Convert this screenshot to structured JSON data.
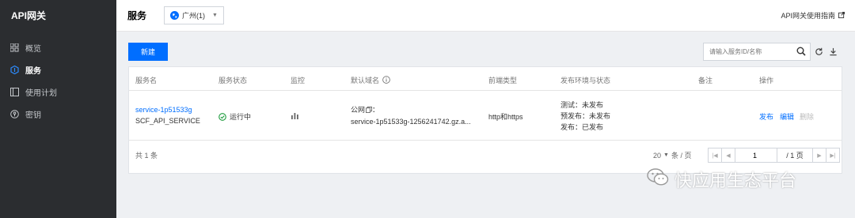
{
  "app": {
    "brand": "API网关"
  },
  "sidebar": {
    "items": [
      {
        "label": "概览",
        "icon": "grid-icon",
        "active": false
      },
      {
        "label": "服务",
        "icon": "service-icon",
        "active": true
      },
      {
        "label": "使用计划",
        "icon": "plan-icon",
        "active": false
      },
      {
        "label": "密钥",
        "icon": "key-icon",
        "active": false
      }
    ]
  },
  "header": {
    "title": "服务",
    "region": "广州(1)",
    "guide_link": "API网关使用指南"
  },
  "toolbar": {
    "new_button": "新建",
    "search_placeholder": "请输入服务ID/名称"
  },
  "table": {
    "headers": [
      "服务名",
      "服务状态",
      "监控",
      "默认域名",
      "前端类型",
      "发布环境与状态",
      "备注",
      "操作"
    ],
    "rows": [
      {
        "name": "service-1p51533g",
        "sub_name": "SCF_API_SERVICE",
        "status": "运行中",
        "domain_label": "公网",
        "domain": "service-1p51533g-1256241742.gz.a...",
        "frontend": "http和https",
        "env_test": "测试：未发布",
        "env_prepub": "预发布：未发布",
        "env_release": "发布：已发布",
        "remark": "",
        "actions": [
          "发布",
          "编辑",
          "删除"
        ]
      }
    ]
  },
  "footer": {
    "total_text": "共 1 条",
    "page_size": "20",
    "page_size_unit": "条 / 页",
    "page_input": "1",
    "page_total": "/ 1 页"
  },
  "watermark": {
    "text": "快应用生态平台"
  },
  "colors": {
    "accent": "#006eff",
    "sidebar_bg": "#2b2d30",
    "success": "#1a9a3a"
  }
}
